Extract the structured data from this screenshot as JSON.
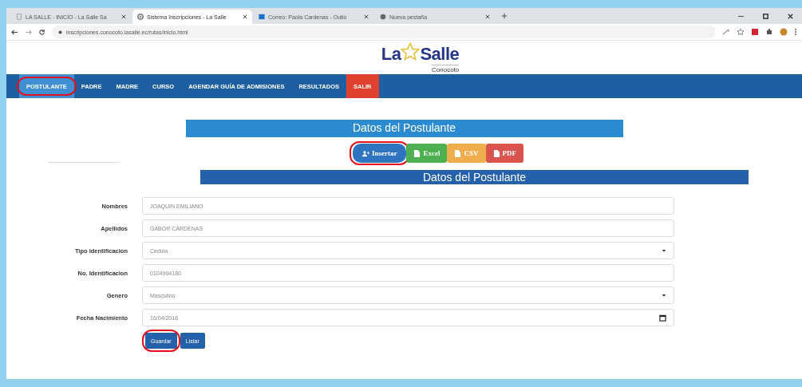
{
  "browser": {
    "tabs": [
      {
        "title": "LA SALLE - INICIO - La Salle Sa",
        "selected": false,
        "kind": "page"
      },
      {
        "title": "Sistema Inscripciones - La Salle",
        "selected": true,
        "kind": "globe"
      },
      {
        "title": "Correo: Paola Cardenas - Outlo",
        "selected": false,
        "kind": "mail"
      },
      {
        "title": "Nueva pestaña",
        "selected": false,
        "kind": "blank"
      }
    ],
    "url": "inscripciones.conocoto.lasalle.ec/rutas/inicio.html"
  },
  "logo": {
    "left": "La",
    "right": "Salle",
    "subtitle": "Conocoto"
  },
  "nav": [
    {
      "label": "POSTULANTE",
      "selected": true,
      "circled": true,
      "kind": "normal"
    },
    {
      "label": "PADRE",
      "selected": false,
      "circled": false,
      "kind": "normal"
    },
    {
      "label": "MADRE",
      "selected": false,
      "circled": false,
      "kind": "normal"
    },
    {
      "label": "CURSO",
      "selected": false,
      "circled": false,
      "kind": "normal"
    },
    {
      "label": "AGENDAR GUÍA DE ADMISIONES",
      "selected": false,
      "circled": false,
      "kind": "normal"
    },
    {
      "label": "RESULTADOS",
      "selected": false,
      "circled": false,
      "kind": "normal"
    },
    {
      "label": "SALIR",
      "selected": false,
      "circled": false,
      "kind": "exit"
    }
  ],
  "page_title": "Datos del Postulante",
  "actions": [
    {
      "label": "Insertar",
      "kind": "insert",
      "circled": true
    },
    {
      "label": "Excel",
      "kind": "excel",
      "circled": false
    },
    {
      "label": "CSV",
      "kind": "csv",
      "circled": false
    },
    {
      "label": "PDF",
      "kind": "pdf",
      "circled": false
    }
  ],
  "form": {
    "title": "Datos del Postulante",
    "fields": [
      {
        "label": "Nombres",
        "value": "JOAQUIN EMILIANO",
        "kind": "text"
      },
      {
        "label": "Apellidos",
        "value": "GABOR CARDENAS",
        "kind": "text"
      },
      {
        "label": "Tipo identificacion",
        "value": "Cedula",
        "kind": "select"
      },
      {
        "label": "No. Identificacion",
        "value": "0104904180",
        "kind": "text"
      },
      {
        "label": "Genero",
        "value": "Masculino",
        "kind": "select"
      },
      {
        "label": "Fecha Nacimiento",
        "value": "16/04/2016",
        "kind": "date"
      }
    ],
    "buttons": [
      {
        "label": "Guardar",
        "circled": true
      },
      {
        "label": "Listar",
        "circled": false
      }
    ]
  }
}
